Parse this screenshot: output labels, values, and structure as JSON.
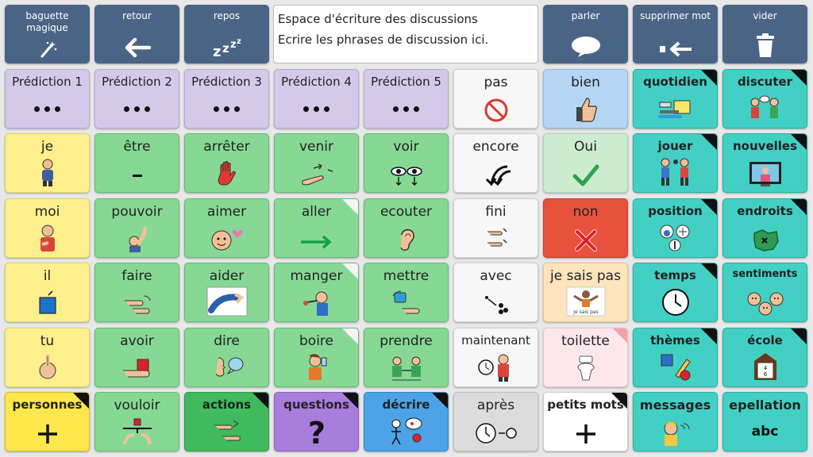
{
  "toolbar": {
    "magic_wand": "baguette\nmagique",
    "back": "retour",
    "rest": "repos",
    "speak": "parler",
    "delete_word": "supprimer mot",
    "clear": "vider"
  },
  "message_box": {
    "line1": "Espace d'écriture des discussions",
    "line2": "Ecrire les phrases de discussion ici."
  },
  "predictions": [
    "Prédiction 1",
    "Prédiction 2",
    "Prédiction 3",
    "Prédiction 4",
    "Prédiction 5"
  ],
  "words": {
    "pas": "pas",
    "bien": "bien",
    "quotidien": "quotidien",
    "discuter": "discuter",
    "je": "je",
    "etre": "être",
    "arreter": "arrêter",
    "venir": "venir",
    "voir": "voir",
    "encore": "encore",
    "oui": "Oui",
    "jouer": "jouer",
    "nouvelles": "nouvelles",
    "moi": "moi",
    "pouvoir": "pouvoir",
    "aimer": "aimer",
    "aller": "aller",
    "ecouter": "ecouter",
    "fini": "fini",
    "non": "non",
    "position": "position",
    "endroits": "endroits",
    "il": "il",
    "faire": "faire",
    "aider": "aider",
    "manger": "manger",
    "mettre": "mettre",
    "avec": "avec",
    "je_sais_pas": "je sais pas",
    "je_sais_pas_caption": "je sais pas",
    "temps": "temps",
    "sentiments": "sentiments",
    "tu": "tu",
    "avoir": "avoir",
    "dire": "dire",
    "boire": "boire",
    "prendre": "prendre",
    "maintenant": "maintenant",
    "toilette": "toilette",
    "themes": "thèmes",
    "ecole": "école",
    "personnes": "personnes",
    "vouloir": "vouloir",
    "actions": "actions",
    "questions": "questions",
    "decrire": "décrire",
    "apres": "après",
    "petits_mots": "petits mots",
    "messages": "messages",
    "epellation": "epellation",
    "abc": "abc"
  }
}
